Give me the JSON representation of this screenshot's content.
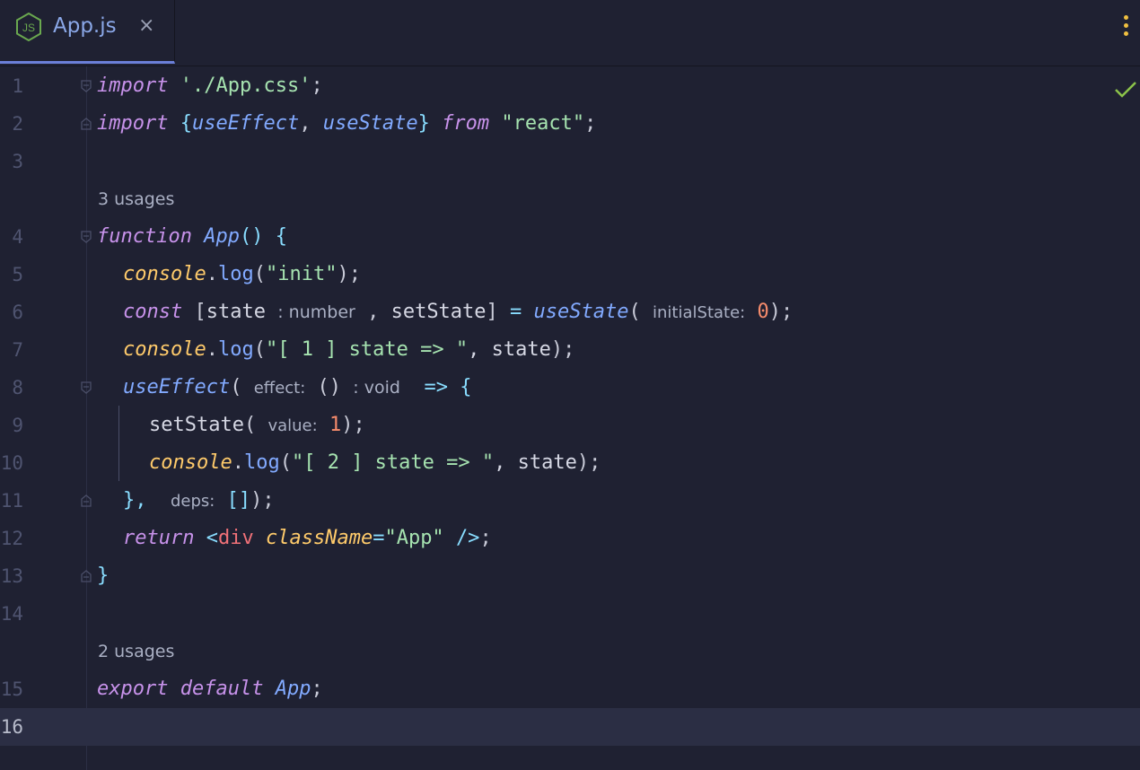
{
  "tab": {
    "title": "App.js",
    "close": "×",
    "icon": "js-file-icon"
  },
  "colors": {
    "background": "#1f2132",
    "current_line": "#2b2e44",
    "keyword": "#c792ea",
    "string": "#a6e3b0",
    "function": "#82aaff",
    "object": "#ffcb6b",
    "number": "#f78c6c"
  },
  "lines": {
    "n1": "1",
    "n2": "2",
    "n3": "3",
    "n4": "4",
    "n5": "5",
    "n6": "6",
    "n7": "7",
    "n8": "8",
    "n9": "9",
    "n10": "10",
    "n11": "11",
    "n12": "12",
    "n13": "13",
    "n14": "14",
    "n15": "15",
    "n16": "16"
  },
  "usages": {
    "app_function": "3 usages",
    "export": "2 usages"
  },
  "code": {
    "l1": {
      "kw": "import",
      "str": "'./App.css'",
      "end": ";"
    },
    "l2": {
      "kw": "import",
      "open": "{",
      "a": "useEffect",
      "comma": ", ",
      "b": "useState",
      "close": "}",
      "from": "from",
      "str": "\"react\"",
      "end": ";"
    },
    "l4": {
      "kw": "function",
      "name": "App",
      "paren": "()",
      "open": "{"
    },
    "l5": {
      "obj": "console",
      "dot": ".",
      "fn": "log",
      "open": "(",
      "str": "\"init\"",
      "close": ");"
    },
    "l6": {
      "kw": "const",
      "open": "[",
      "a": "state",
      "type": ": number",
      "comma": " ,",
      "b": "setState",
      "close": "]",
      "eq": "=",
      "fn": "useState",
      "paren": "(",
      "hint": "initialState:",
      "num": "0",
      "end": ");"
    },
    "l7": {
      "obj": "console",
      "dot": ".",
      "fn": "log",
      "open": "(",
      "str": "\"[ 1 ] state => \"",
      "rest": ", state",
      "close": ");"
    },
    "l8": {
      "fn": "useEffect",
      "paren": "(",
      "hint": "effect:",
      "args": "()",
      "type": ": void",
      "arrow": "=>",
      "open": "{"
    },
    "l9": {
      "name": "setState",
      "paren": "(",
      "hint": "value:",
      "num": "1",
      "end": ");"
    },
    "l10": {
      "obj": "console",
      "dot": ".",
      "fn": "log",
      "open": "(",
      "str": "\"[ 2 ] state => \"",
      "rest": ", state",
      "close": ");"
    },
    "l11": {
      "close": "},",
      "hint": "deps:",
      "arr": "[]",
      "end": ");"
    },
    "l12": {
      "kw": "return",
      "lt": "<",
      "tag": "div",
      "attr": "className",
      "eq": "=",
      "str": "\"App\"",
      "gt": "/>",
      "end": ";"
    },
    "l13": {
      "close": "}"
    },
    "l15": {
      "kw1": "export",
      "kw2": "default",
      "name": "App",
      "end": ";"
    }
  }
}
